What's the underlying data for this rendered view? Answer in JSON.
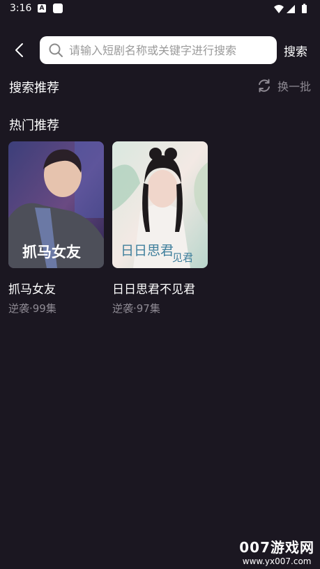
{
  "status_bar": {
    "time": "3:16",
    "notif_a_letter": "A"
  },
  "header": {
    "search_placeholder": "请输入短剧名称或关键字进行搜索",
    "search_button": "搜索"
  },
  "recommend": {
    "title": "搜索推荐",
    "refresh_label": "换一批"
  },
  "hot": {
    "title": "热门推荐",
    "items": [
      {
        "title": "抓马女友",
        "meta": "逆袭·99集",
        "cover_text": "抓马女友",
        "cover_colors": [
          "#3c3f7a",
          "#6a4a82",
          "#2a2450"
        ]
      },
      {
        "title": "日日思君不见君",
        "meta": "逆袭·97集",
        "cover_text": "日日思君",
        "cover_text_2": "见君",
        "cover_colors": [
          "#d9e8df",
          "#f3e9e4",
          "#b9d6cc"
        ]
      }
    ]
  },
  "watermark": {
    "logo": "007游戏网",
    "url": "www.yx007.com"
  }
}
